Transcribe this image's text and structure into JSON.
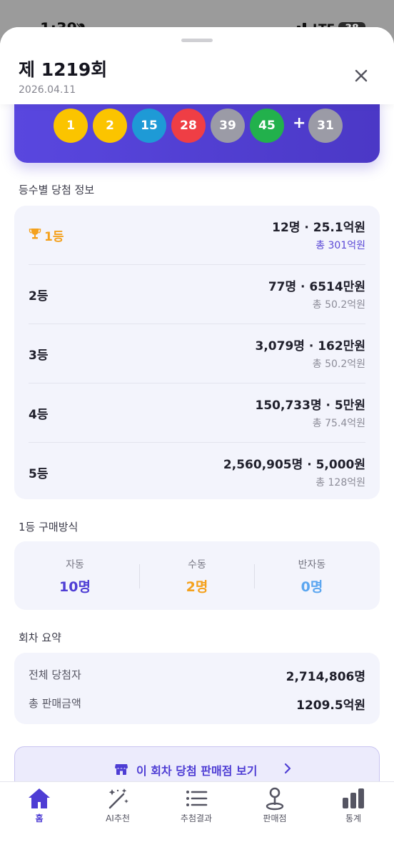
{
  "status_bar": {
    "time": "1:39",
    "network": "LTE",
    "battery": "38"
  },
  "header": {
    "title": "제 1219회",
    "date": "2026.04.11"
  },
  "balls": {
    "main": [
      {
        "number": "1",
        "color": "#fbc400"
      },
      {
        "number": "2",
        "color": "#fbc400"
      },
      {
        "number": "15",
        "color": "#1e9ad6"
      },
      {
        "number": "28",
        "color": "#ef3e45"
      },
      {
        "number": "39",
        "color": "#9b9ba6"
      },
      {
        "number": "45",
        "color": "#22b14c"
      }
    ],
    "plus": "+",
    "bonus": {
      "number": "31",
      "color": "#9b9ba6"
    }
  },
  "prize_section": {
    "label": "등수별 당첨 정보",
    "ranks": [
      {
        "name": "1등",
        "main": "12명 · 25.1억원",
        "sub": "총 301억원"
      },
      {
        "name": "2등",
        "main": "77명 · 6514만원",
        "sub": "총 50.2억원"
      },
      {
        "name": "3등",
        "main": "3,079명 · 162만원",
        "sub": "총 50.2억원"
      },
      {
        "name": "4등",
        "main": "150,733명 · 5만원",
        "sub": "총 75.4억원"
      },
      {
        "name": "5등",
        "main": "2,560,905명 · 5,000원",
        "sub": "총 128억원"
      }
    ]
  },
  "method_section": {
    "label": "1등 구매방식",
    "items": [
      {
        "label": "자동",
        "value": "10명",
        "color": "#4e3dd4"
      },
      {
        "label": "수동",
        "value": "2명",
        "color": "#f4a11d"
      },
      {
        "label": "반자동",
        "value": "0명",
        "color": "#5ba6f0"
      }
    ]
  },
  "summary_section": {
    "label": "회차 요약",
    "rows": [
      {
        "label": "전체 당첨자",
        "value": "2,714,806명"
      },
      {
        "label": "총 판매금액",
        "value": "1209.5억원"
      }
    ]
  },
  "store_button": {
    "label": "이 회차 당첨 판매점 보기"
  },
  "tabbar": {
    "tabs": [
      {
        "label": "홈",
        "icon": "home-icon",
        "active": true
      },
      {
        "label": "AI추천",
        "icon": "magic-wand-icon"
      },
      {
        "label": "추첨결과",
        "icon": "list-icon"
      },
      {
        "label": "판매점",
        "icon": "map-pin-icon"
      },
      {
        "label": "통계",
        "icon": "bar-chart-icon"
      }
    ]
  },
  "colors": {
    "accent": "#4e3dd4",
    "gold": "#f4a11d"
  }
}
